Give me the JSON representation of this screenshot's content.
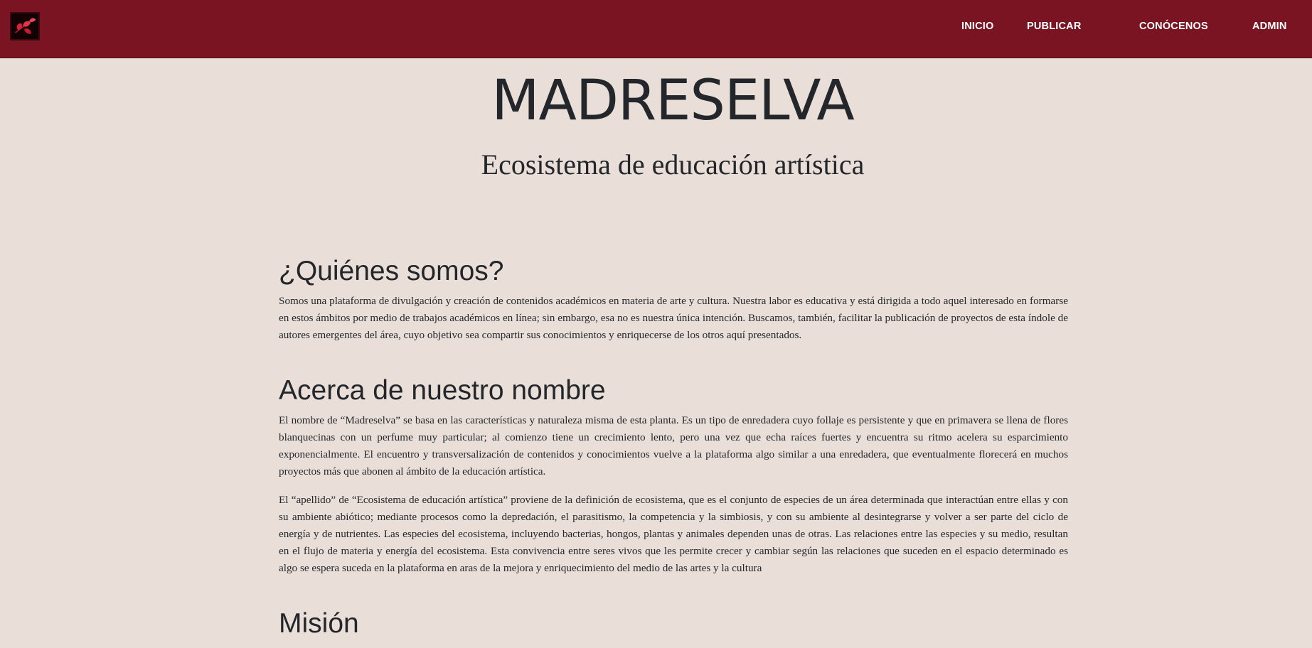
{
  "navbar": {
    "logo_icon": "vine-leaf-logo-icon",
    "links": [
      "INICIO",
      "PUBLICAR",
      "CONÓCENOS",
      "ADMIN"
    ]
  },
  "hero": {
    "title": "MADRESELVA",
    "subtitle": "Ecosistema de educación artística"
  },
  "sections": {
    "quienes": {
      "heading": "¿Quiénes somos?",
      "paragraph": "Somos una plataforma de divulgación y creación de contenidos académicos en materia de arte y cultura. Nuestra labor es educativa y está dirigida a todo aquel interesado en formarse en estos ámbitos por medio de trabajos académicos en línea; sin embargo, esa no es nuestra única intención. Buscamos, también, facilitar la publicación de proyectos de esta índole de autores emergentes del área, cuyo objetivo sea compartir sus conocimientos y enriquecerse de los otros aquí presentados."
    },
    "acerca": {
      "heading": "Acerca de nuestro nombre",
      "paragraph1": "El nombre de “Madreselva” se basa en las características y naturaleza misma de esta planta. Es un tipo de enredadera cuyo follaje es persistente y que en primavera se llena de flores blanquecinas con un perfume muy particular; al comienzo tiene un crecimiento lento, pero una vez que echa raíces fuertes y encuentra su ritmo acelera su esparcimiento exponencialmente. El encuentro y transversalización de contenidos y conocimientos vuelve a la plataforma algo similar a una enredadera, que eventualmente florecerá en muchos proyectos más que abonen al ámbito de la educación artística.",
      "paragraph2": "El “apellido” de “Ecosistema de educación artística” proviene de la definición de ecosistema, que es el conjunto de especies de un área determinada que interactúan entre ellas y con su ambiente abiótico; mediante procesos como la depredación, el parasitismo, la competencia y la simbiosis, y con su ambiente al desintegrarse y volver a ser parte del ciclo de energía y de nutrientes. Las especies del ecosistema, incluyendo bacterias, hongos, plantas y animales dependen unas de otras. Las relaciones entre las especies y su medio, resultan en el flujo de materia y energía del ecosistema. Esta convivencia entre seres vivos que les permite crecer y cambiar según las relaciones que suceden en el espacio determinado es algo se espera suceda en la plataforma en aras de la mejora y enriquecimiento del medio de las artes y la cultura"
    },
    "mision": {
      "heading": "Misión"
    }
  },
  "colors": {
    "navbar_bg": "#7a1423",
    "page_bg": "#eadfd8",
    "text": "#23262b"
  }
}
